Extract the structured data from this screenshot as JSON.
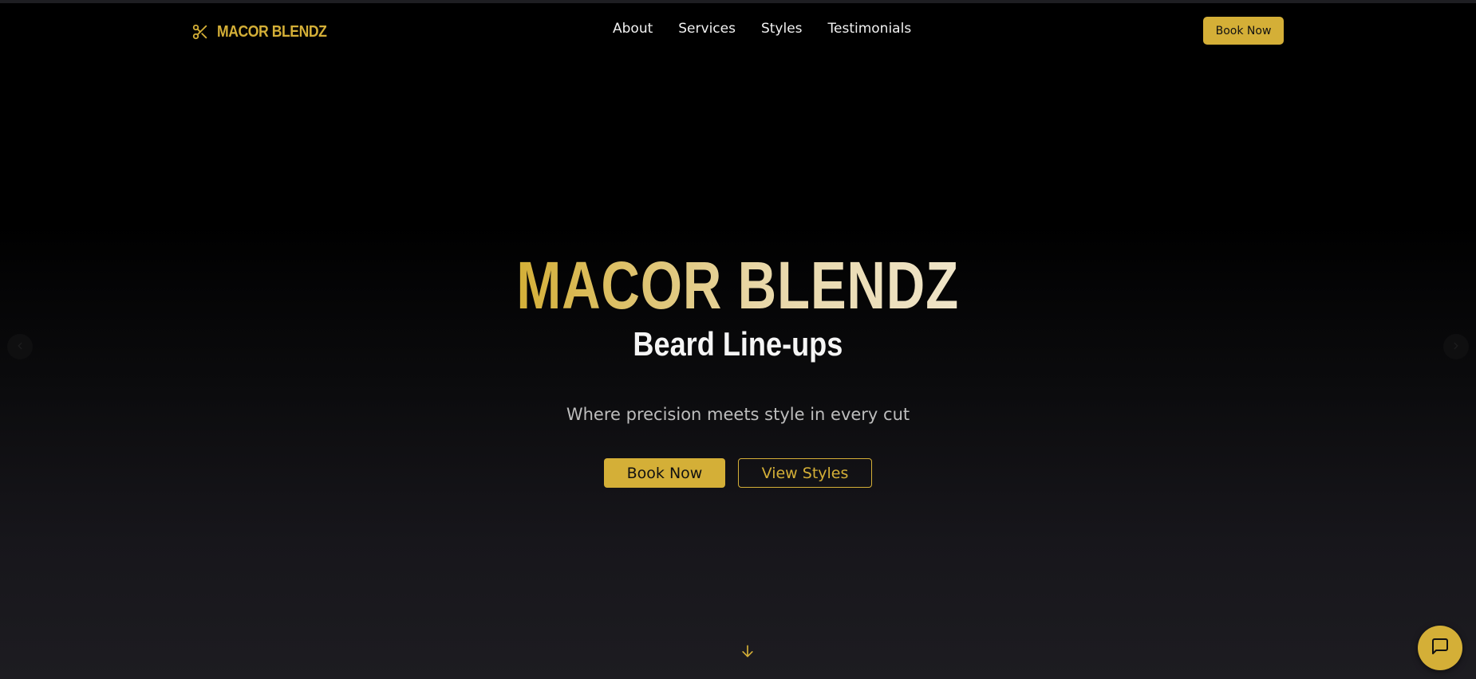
{
  "brand": {
    "name": "MACOR BLENDZ",
    "icon": "scissors-icon"
  },
  "nav": {
    "links": [
      "About",
      "Services",
      "Styles",
      "Testimonials"
    ],
    "cta_label": "Book Now"
  },
  "hero": {
    "title": "MACOR BLENDZ",
    "subtitle": "Beard Line-ups",
    "tagline": "Where precision meets style in every cut",
    "primary_button": "Book Now",
    "secondary_button": "View Styles"
  },
  "icons": {
    "prev": "chevron-left-icon",
    "next": "chevron-right-icon",
    "scroll": "arrow-down-icon",
    "chat": "chat-bubble-icon"
  },
  "colors": {
    "accent": "#d4af37",
    "background": "#000000",
    "text": "#f2f2f2",
    "muted_text": "#bdbdbd"
  }
}
